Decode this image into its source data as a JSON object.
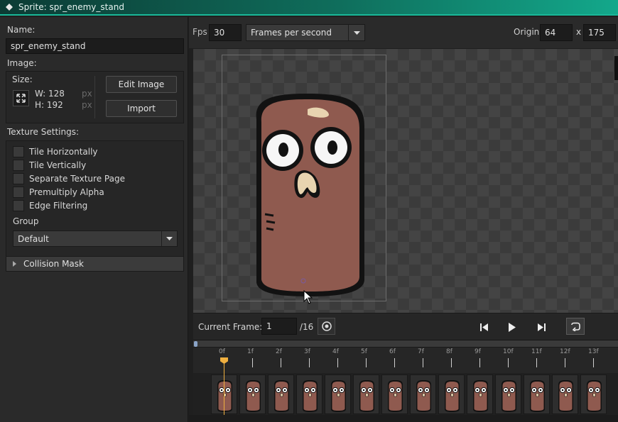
{
  "window": {
    "title": "Sprite: spr_enemy_stand"
  },
  "left_panel": {
    "name_label": "Name:",
    "name_value": "spr_enemy_stand",
    "image_label": "Image:",
    "size_label": "Size:",
    "width_text": "W: 128",
    "height_text": "H: 192",
    "unit_w": "px",
    "unit_h": "px",
    "edit_image_label": "Edit Image",
    "import_label": "Import",
    "texture_settings_label": "Texture Settings:",
    "checkboxes": [
      {
        "label": "Tile Horizontally",
        "checked": false
      },
      {
        "label": "Tile Vertically",
        "checked": false
      },
      {
        "label": "Separate Texture Page",
        "checked": false
      },
      {
        "label": "Premultiply Alpha",
        "checked": false
      },
      {
        "label": "Edge Filtering",
        "checked": false
      }
    ],
    "group_label": "Group",
    "group_value": "Default",
    "collision_mask_label": "Collision Mask"
  },
  "toolbar": {
    "fps_label": "Fps",
    "fps_value": "30",
    "speed_mode": "Frames per second",
    "origin_label": "Origin",
    "origin_x": "64",
    "origin_sep": "x",
    "origin_y": "175"
  },
  "playback": {
    "current_frame_label": "Current Frame:",
    "current_frame_value": "1",
    "total_frames_text": "/16"
  },
  "timeline": {
    "ruler_labels": [
      "0f",
      "1f",
      "2f",
      "3f",
      "4f",
      "5f",
      "6f",
      "7f",
      "8f",
      "9f",
      "10f",
      "11f",
      "12f",
      "13f"
    ],
    "frame_count": 14
  },
  "colors": {
    "title_gradient_end": "#13a88b",
    "playhead": "#f0b040",
    "sprite_body": "#8f5a4f"
  }
}
